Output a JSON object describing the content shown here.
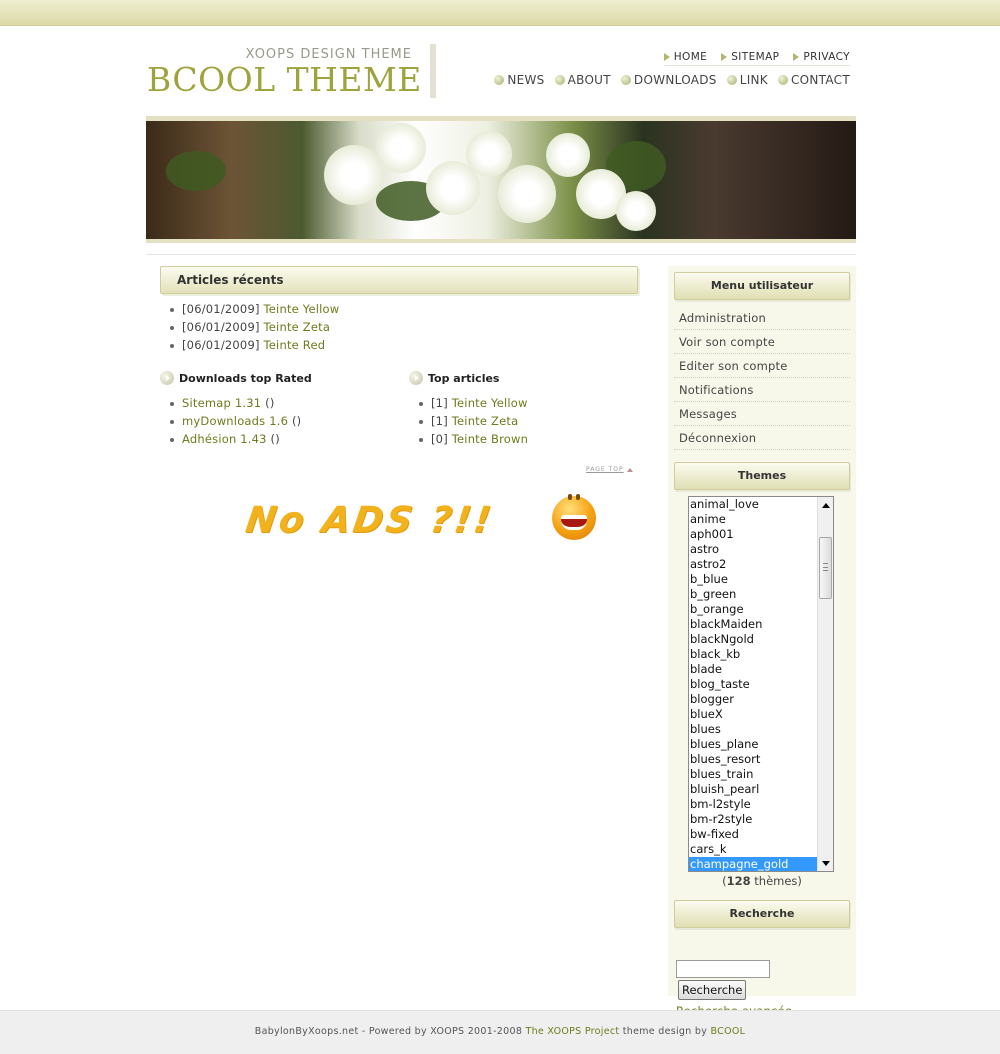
{
  "header": {
    "logo_subtitle": "XOOPS DESIGN THEME",
    "logo_title": "BCOOL THEME",
    "top_links": [
      "HOME",
      "SITEMAP",
      "PRIVACY"
    ],
    "main_nav": [
      "NEWS",
      "ABOUT",
      "DOWNLOADS",
      "LINK",
      "CONTACT"
    ]
  },
  "recent_articles": {
    "title": "Articles récents",
    "items": [
      {
        "date": "[06/01/2009]",
        "link": "Teinte Yellow"
      },
      {
        "date": "[06/01/2009]",
        "link": "Teinte Zeta"
      },
      {
        "date": "[06/01/2009]",
        "link": "Teinte Red"
      }
    ]
  },
  "downloads_top_rated": {
    "title": "Downloads top Rated",
    "items": [
      {
        "link": "Sitemap 1.31",
        "suffix": " ()"
      },
      {
        "link": "myDownloads 1.6",
        "suffix": " ()"
      },
      {
        "link": "Adhésion 1.43",
        "suffix": " ()"
      }
    ]
  },
  "top_articles": {
    "title": "Top articles",
    "items": [
      {
        "count": "[1]",
        "link": "Teinte Yellow"
      },
      {
        "count": "[1]",
        "link": "Teinte Zeta"
      },
      {
        "count": "[0]",
        "link": "Teinte Brown"
      }
    ]
  },
  "page_top": "PAGE TOP",
  "ad_banner": {
    "text": "No ADS ?!!"
  },
  "user_menu": {
    "title": "Menu utilisateur",
    "items": [
      "Administration",
      "Voir son compte",
      "Editer son compte",
      "Notifications",
      "Messages",
      "Déconnexion"
    ]
  },
  "themes": {
    "title": "Themes",
    "options": [
      "animal_love",
      "anime",
      "aph001",
      "astro",
      "astro2",
      "b_blue",
      "b_green",
      "b_orange",
      "blackMaiden",
      "blackNgold",
      "black_kb",
      "blade",
      "blog_taste",
      "blogger",
      "blueX",
      "blues",
      "blues_plane",
      "blues_resort",
      "blues_train",
      "bluish_pearl",
      "bm-l2style",
      "bm-r2style",
      "bw-fixed",
      "cars_k",
      "champagne_gold"
    ],
    "selected": "champagne_gold",
    "count_open": "(",
    "count": "128",
    "count_label": " thèmes)"
  },
  "search": {
    "title": "Recherche",
    "input_value": "",
    "button_label": "Recherche",
    "advanced_link": "Recherche avancée"
  },
  "footer": {
    "prefix": "BabylonByXoops.net - Powered by XOOPS 2001-2008 ",
    "project_link": "The XOOPS Project",
    "middle": " theme design by ",
    "designer_link": "BCOOL"
  },
  "colors": {
    "accent_link": "#707a1c",
    "logo": "#9ea33c",
    "selected_option": "#3399ff"
  }
}
